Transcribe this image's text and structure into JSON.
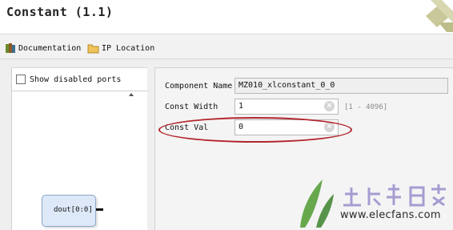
{
  "window": {
    "title": "Constant (1.1)"
  },
  "toolbar": {
    "documentation_label": "Documentation",
    "ip_location_label": "IP Location",
    "documentation_icon": "books-icon",
    "ip_location_icon": "folder-icon"
  },
  "symbol_panel": {
    "show_disabled_ports_label": "Show disabled ports",
    "show_disabled_ports_checked": false,
    "port_label": "dout[0:0]"
  },
  "parameters": {
    "component_name_label": "Component Name",
    "component_name_value": "MZ010_xlconstant_0_0",
    "const_width_label": "Const Width",
    "const_width_value": "1",
    "const_width_range": "[1 - 4096]",
    "const_val_label": "Const Val",
    "const_val_value": "0"
  },
  "watermark": {
    "url": "www.elecfans.com"
  },
  "colors": {
    "highlight_ellipse": "#b3262c",
    "port_block_fill": "#dde9f8"
  }
}
